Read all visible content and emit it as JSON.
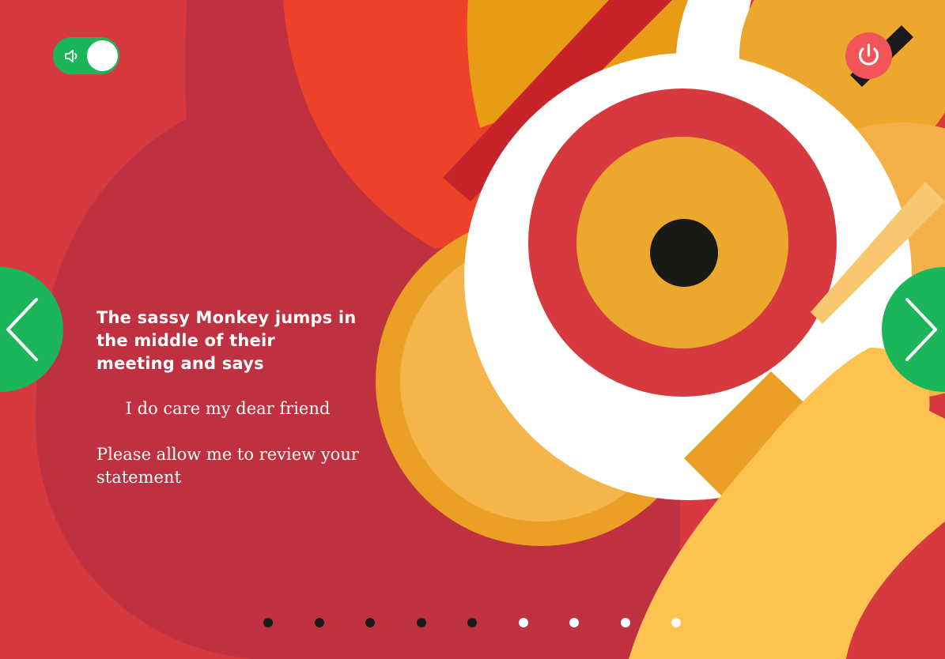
{
  "colors": {
    "background": "#d63a3f",
    "toggle_green": "#1cb65a",
    "power_red": "#f1555a",
    "text": "#ffffff",
    "dot_inactive": "#1a1a1a",
    "dot_active": "#ffffff"
  },
  "controls": {
    "sound_toggle": {
      "icon": "speaker-icon",
      "on": true
    },
    "power_button": {
      "icon": "power-icon"
    },
    "prev_button": {
      "icon": "chevron-left-icon"
    },
    "next_button": {
      "icon": "chevron-right-icon"
    }
  },
  "story": {
    "narration": "The sassy Monkey jumps in the middle of their meeting and says",
    "dialogue_line1": "I do care my dear friend",
    "dialogue_line2": "Please allow me to review your statement"
  },
  "pagination": {
    "total": 9,
    "current": 6,
    "states": [
      "inactive",
      "inactive",
      "inactive",
      "inactive",
      "inactive",
      "active",
      "active",
      "active",
      "active"
    ]
  }
}
